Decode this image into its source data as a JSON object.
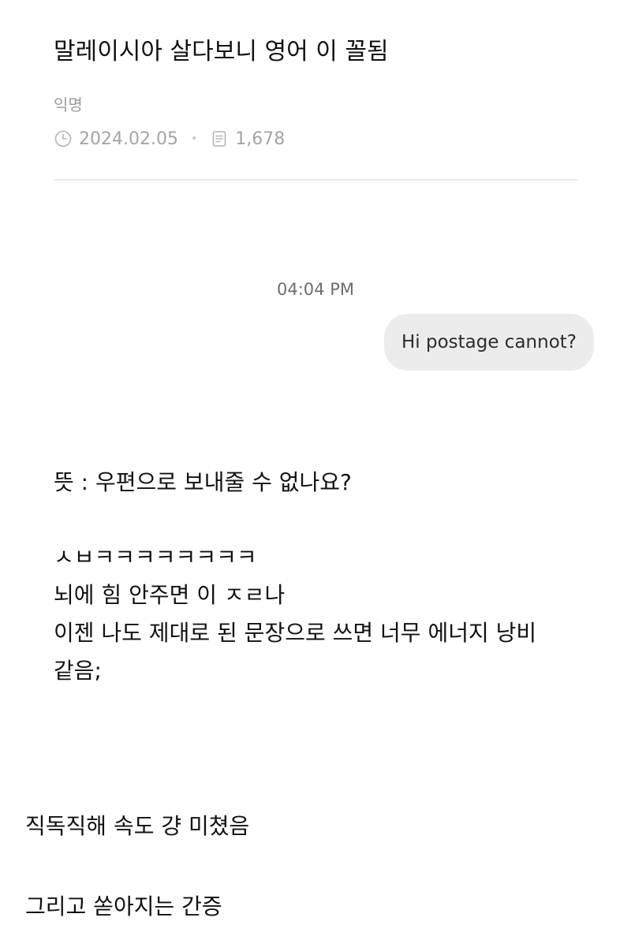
{
  "post": {
    "title": "말레이시아 살다보니 영어 이 꼴됨",
    "author": "익명",
    "date": "2024.02.05",
    "views": "1,678",
    "icons": {
      "date": "clock-icon",
      "views": "document-icon"
    }
  },
  "chat": {
    "time": "04:04 PM",
    "message": "Hi postage cannot?"
  },
  "body": {
    "meaning": "뜻 : 우편으로 보내줄 수 없나요?",
    "lines": [
      "ㅅㅂㅋㅋㅋㅋㅋㅋㅋㅋ",
      "뇌에 힘 안주면 이 ㅈㄹ나",
      "이젠 나도 제대로 된 문장으로 쓰면 너무 에너지 낭비",
      "같음;"
    ]
  },
  "comments": [
    "직독직해 속도 걍 미쳤음",
    "그리고 쏟아지는 간증"
  ],
  "colors": {
    "meta_text": "#a4a4a4",
    "divider": "#ebebeb",
    "bubble_bg": "#ececec"
  }
}
